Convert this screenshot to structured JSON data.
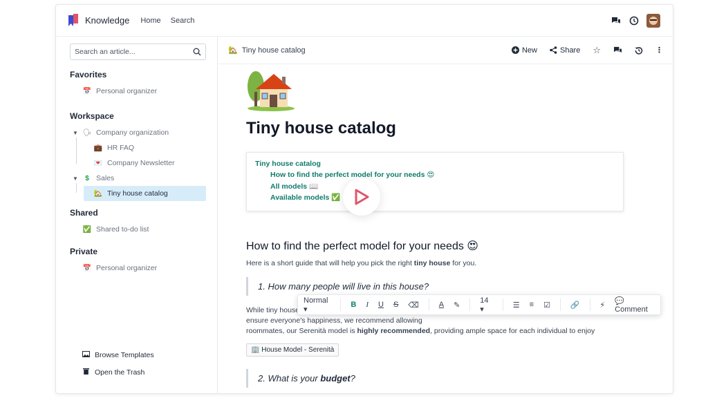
{
  "topbar": {
    "brand": "Knowledge",
    "nav": [
      "Home",
      "Search"
    ]
  },
  "sidebar": {
    "search_placeholder": "Search an article...",
    "favorites_title": "Favorites",
    "favorites": [
      {
        "emoji": "📅",
        "label": "Personal organizer"
      }
    ],
    "workspace_title": "Workspace",
    "workspace": [
      {
        "emoji": "🗣",
        "label": "Company organization"
      },
      {
        "emoji": "💼",
        "label": "HR FAQ"
      },
      {
        "emoji": "💌",
        "label": "Company Newsletter"
      },
      {
        "emoji": "$",
        "label": "Sales"
      },
      {
        "emoji": "🏡",
        "label": "Tiny house catalog"
      }
    ],
    "shared_title": "Shared",
    "shared": [
      {
        "emoji": "✅",
        "label": "Shared to-do list"
      }
    ],
    "private_title": "Private",
    "private": [
      {
        "emoji": "📅",
        "label": "Personal organizer"
      }
    ],
    "bottom": [
      "Browse Templates",
      "Open the Trash"
    ]
  },
  "main": {
    "breadcrumb": "Tiny house catalog",
    "breadcrumb_emoji": "🏡",
    "actions": {
      "new": "New",
      "share": "Share"
    },
    "title": "Tiny house catalog",
    "toc": [
      "Tiny house catalog",
      "How to find the perfect model for your needs 😍",
      "All models 📖",
      "Available models ✅"
    ],
    "h2": "How to find the perfect model for your needs 😍",
    "intro_pre": "Here is a short guide that will help you pick the right ",
    "intro_bold": "tiny house",
    "intro_post": " for you.",
    "q1": "1. How many people will live in this house?",
    "para_line1": "While tiny house",
    "para_line2": "ensure everyone's happiness, we recommend allowing",
    "para_line3_pre": "roommates, our Serenità model is ",
    "para_line3_bold": "highly recommended",
    "para_line3_post": ", providing ample space for each individual to enjoy",
    "snippet": "House Model - Serenità",
    "q2_pre": "2. What is your ",
    "q2_bold": "budget",
    "q2_post": "?"
  },
  "toolbar": {
    "style": "Normal",
    "font_size": "14",
    "comment": "Comment"
  },
  "colors": {
    "accent": "#0e7c6b",
    "play": "#e0546a"
  }
}
